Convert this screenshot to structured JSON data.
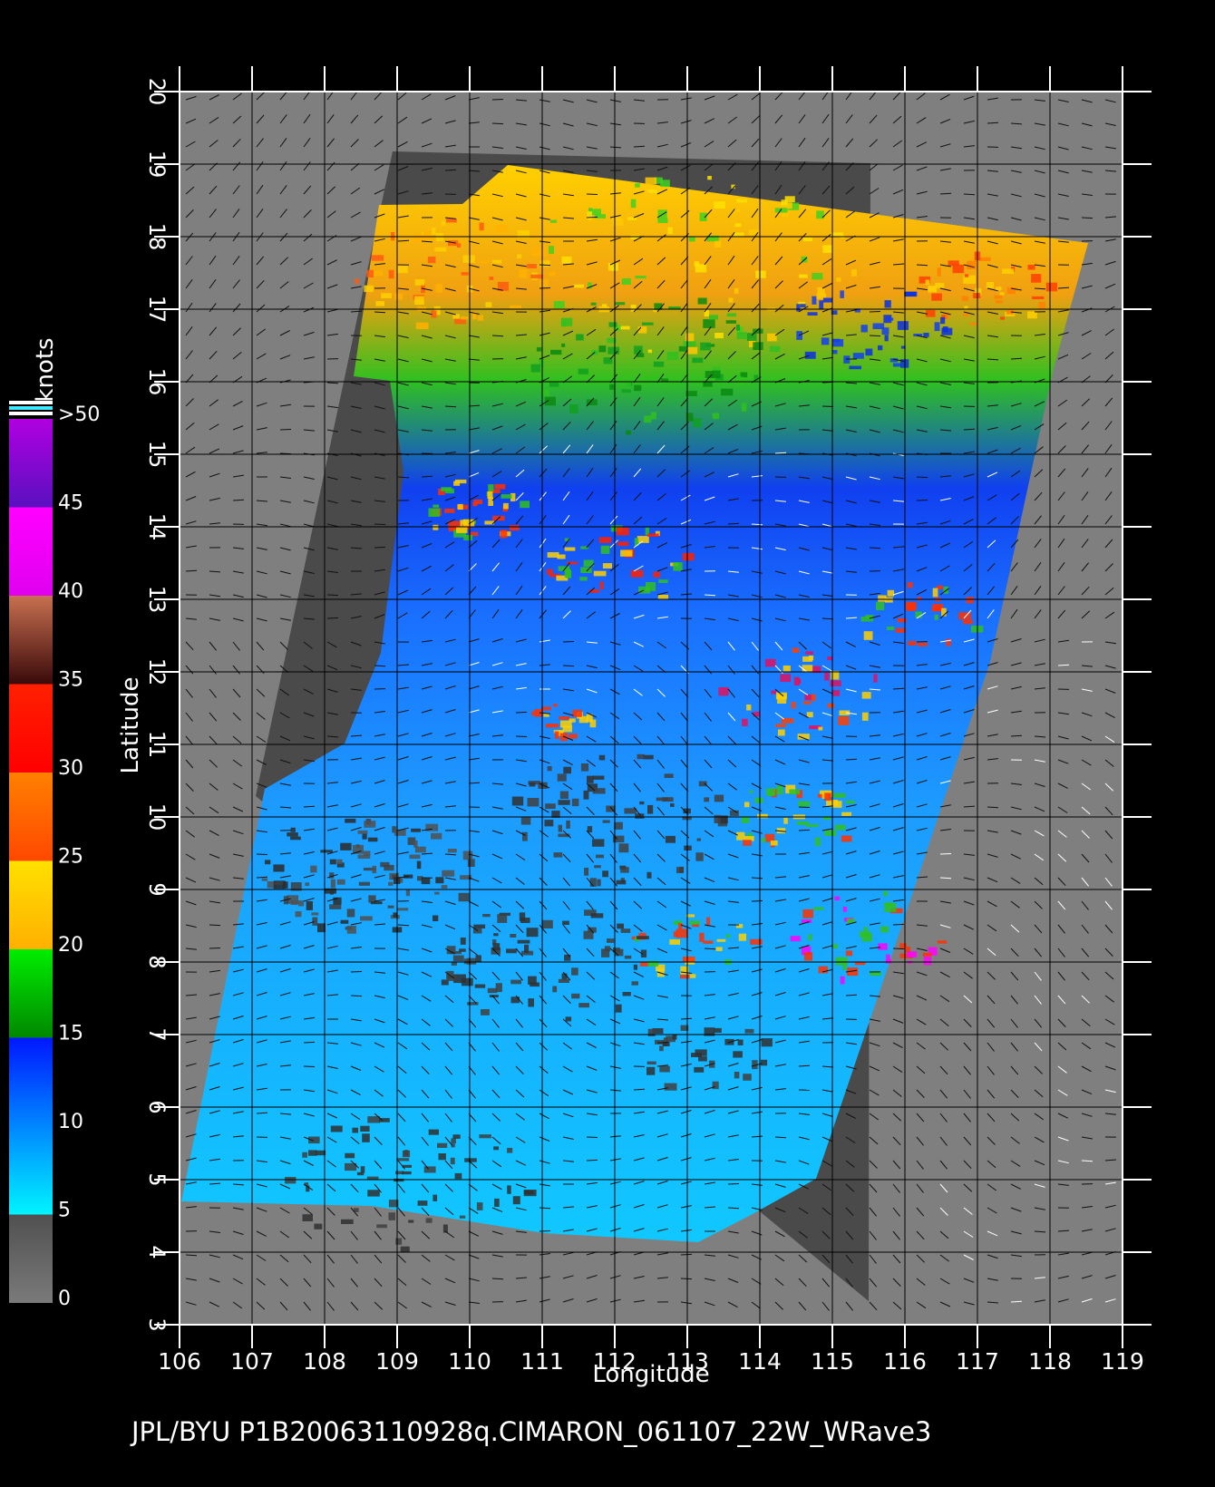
{
  "colorbar": {
    "unit": "knots",
    "labels": [
      ">50",
      "45",
      "40",
      "35",
      "30",
      "25",
      "20",
      "15",
      "10",
      "5",
      "0"
    ],
    "bands": [
      {
        "from": 0,
        "to": 5,
        "top": "#505050",
        "bottom": "#7a7a7a"
      },
      {
        "from": 5,
        "to": 15,
        "top": "#0018ff",
        "bottom": "#00f4ff"
      },
      {
        "from": 15,
        "to": 20,
        "top": "#00ee00",
        "bottom": "#008800"
      },
      {
        "from": 20,
        "to": 25,
        "top": "#ffe000",
        "bottom": "#ffb000"
      },
      {
        "from": 25,
        "to": 30,
        "top": "#ff8000",
        "bottom": "#ff4800"
      },
      {
        "from": 30,
        "to": 35,
        "top": "#ff2000",
        "bottom": "#ff0000"
      },
      {
        "from": 35,
        "to": 40,
        "top": "#c87050",
        "bottom": "#3a0a0a"
      },
      {
        "from": 40,
        "to": 45,
        "top": "#ff00ff",
        "bottom": "#e000f0"
      },
      {
        "from": 45,
        "to": 50,
        "top": "#b000e0",
        "bottom": "#5a10c0"
      }
    ]
  },
  "map": {
    "lon_range": [
      106,
      119
    ],
    "lat_range": [
      3,
      20
    ],
    "lon_ticks": [
      "106",
      "107",
      "108",
      "109",
      "110",
      "111",
      "112",
      "113",
      "114",
      "115",
      "116",
      "117",
      "118",
      "119"
    ],
    "lat_ticks": [
      "3",
      "4",
      "5",
      "6",
      "7",
      "8",
      "9",
      "10",
      "11",
      "12",
      "13",
      "14",
      "15",
      "16",
      "17",
      "18",
      "19",
      "20"
    ],
    "xlabel": "Longitude",
    "ylabel": "Latitude",
    "colors": {
      "background": "#000000",
      "map_fill": "#7f7f7f",
      "swath_nodata": "#4a4a4a",
      "grid": "#000000",
      "frame": "#ffffff"
    }
  },
  "caption": "JPL/BYU  P1B20063110928q.CIMARON_061107_22W_WRave3"
}
